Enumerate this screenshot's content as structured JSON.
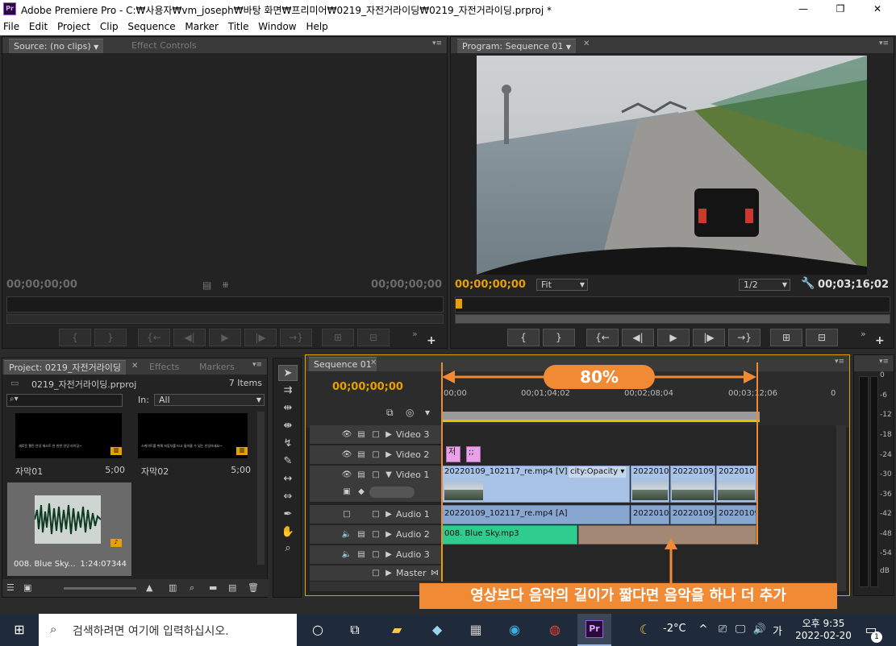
{
  "window": {
    "logo": "Pr",
    "title": "Adobe Premiere Pro - C:₩사용자₩vm_joseph₩바탕 화면₩프리미어₩0219_자전거라이딩₩0219_자전거라이딩.prproj *",
    "minimize": "—",
    "maximize": "❐",
    "close": "✕"
  },
  "menu": [
    "File",
    "Edit",
    "Project",
    "Clip",
    "Sequence",
    "Marker",
    "Title",
    "Window",
    "Help"
  ],
  "source_panel": {
    "tab_source": "Source: (no clips)",
    "tab_effect_controls": "Effect Controls",
    "timecode_in": "00;00;00;00",
    "timecode_out": "00;00;00;00"
  },
  "program_panel": {
    "tab": "Program: Sequence 01",
    "timecode_current": "00;00;00;00",
    "fit": "Fit",
    "resolution": "1/2",
    "timecode_duration": "00;03;16;02"
  },
  "project_panel": {
    "tab_project": "Project: 0219_자전거라이딩",
    "tab_effects": "Effects",
    "tab_markers": "Markers",
    "project_file": "0219_자전거라이딩.prproj",
    "item_count": "7 Items",
    "search_icon_label": "⌕▾",
    "in_label": "In:",
    "in_value": "All",
    "items": [
      {
        "name": "자막01",
        "duration": "5;00",
        "caption": "새로운 챌린 안녕 테스트 안 한번 안녕 라이딩~"
      },
      {
        "name": "자막02",
        "duration": "5;00",
        "caption": "스케이트를 취해 자동차를 타고 돌아올 수 있는 안녕하세요~"
      },
      {
        "name": "008. Blue Sky...",
        "duration": "1:24:07344",
        "caption": ""
      }
    ]
  },
  "timeline": {
    "tab": "Sequence 01",
    "timecode": "00;00;00;00",
    "ruler": [
      "00;00",
      "00;01;04;02",
      "00;02;08;04",
      "00;03;12;06",
      "0"
    ],
    "tracks": [
      {
        "name": "Video 3"
      },
      {
        "name": "Video 2"
      },
      {
        "name": "Video 1"
      },
      {
        "name": "Audio 1"
      },
      {
        "name": "Audio 2"
      },
      {
        "name": "Audio 3"
      },
      {
        "name": "Master"
      }
    ],
    "clips": {
      "v2_a": "저",
      "v2_b": ";;",
      "v1_main": "20220109_102117_re.mp4 [V]",
      "v1_effect": "city:Opacity ▾",
      "v1_c2": "2022010",
      "v1_c3": "20220109_",
      "v1_c4": "2022010",
      "a1_main": "20220109_102117_re.mp4 [A]",
      "a1_c2": "2022010",
      "a1_c3": "20220109_",
      "a1_c4": "20220109",
      "a2_main": "008. Blue Sky.mp3"
    }
  },
  "audio_meter": {
    "labels": [
      "0",
      "-6",
      "-12",
      "-18",
      "-24",
      "-30",
      "-36",
      "-42",
      "-48",
      "-54"
    ],
    "unit": "dB"
  },
  "annotations": {
    "percent": "80%",
    "note": "영상보다 음악의 길이가 짧다면 음악을 하나 더 추가",
    "color": "#f08a35"
  },
  "taskbar": {
    "search_placeholder": "검색하려면 여기에 입력하십시오.",
    "weather": "-2°C",
    "ime": "가",
    "time": "오후 9:35",
    "date": "2022-02-20",
    "notify_count": "1"
  }
}
